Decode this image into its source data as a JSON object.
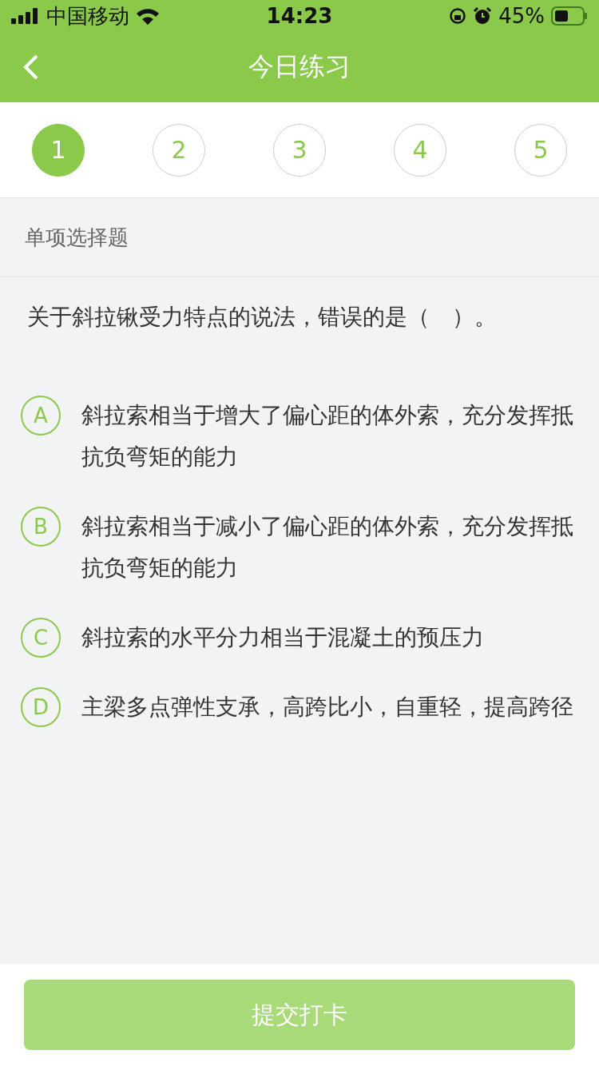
{
  "status_bar": {
    "carrier": "中国移动",
    "time": "14:23",
    "battery": "45%"
  },
  "nav": {
    "title": "今日练习"
  },
  "steps": [
    {
      "label": "1",
      "selected": true
    },
    {
      "label": "2",
      "selected": false
    },
    {
      "label": "3",
      "selected": false
    },
    {
      "label": "4",
      "selected": false
    },
    {
      "label": "5",
      "selected": false
    }
  ],
  "question_type": "单项选择题",
  "question": "关于斜拉锹受力特点的说法，错误的是（　）。",
  "options": [
    {
      "letter": "A",
      "text": "斜拉索相当于增大了偏心距的体外索，充分发挥抵抗负弯矩的能力",
      "selected": false
    },
    {
      "letter": "B",
      "text": "斜拉索相当于减小了偏心距的体外索，充分发挥抵抗负弯矩的能力",
      "selected": false
    },
    {
      "letter": "C",
      "text": "斜拉索的水平分力相当于混凝土的预压力",
      "selected": false
    },
    {
      "letter": "D",
      "text": "主梁多点弹性支承，高跨比小，自重轻，提高跨径",
      "selected": false
    }
  ],
  "submit": {
    "label": "提交打卡",
    "disabled": true
  }
}
